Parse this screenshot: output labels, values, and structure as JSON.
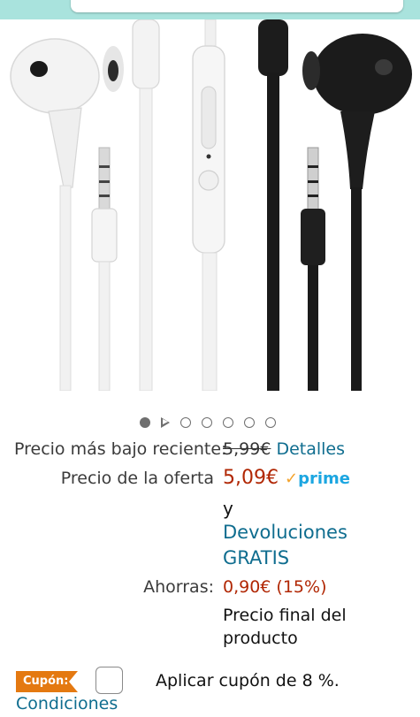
{
  "pricing": {
    "recent_low_label": "Precio más bajo reciente:",
    "recent_low_value": "5,99€",
    "details_link": "Detalles",
    "offer_label": "Precio de la oferta",
    "offer_price": "5,09€",
    "prime_check": "✓",
    "prime_text": "prime",
    "conj": "y",
    "returns_line1": "Devoluciones",
    "returns_line2": "GRATIS",
    "savings_label": "Ahorras:",
    "savings_value": "0,90€ (15%)",
    "final_line1": "Precio final del",
    "final_line2": "producto"
  },
  "coupon": {
    "badge": "Cupón:",
    "apply_text": "Aplicar cupón de 8 %.",
    "conditions_link": "Condiciones"
  },
  "carousel": {
    "active_index": 0,
    "total": 7
  },
  "colors": {
    "price": "#b12704",
    "link": "#0f6d8f",
    "prime": "#1ca6e1",
    "coupon": "#e47911",
    "topbar": "#a9e3dd"
  }
}
